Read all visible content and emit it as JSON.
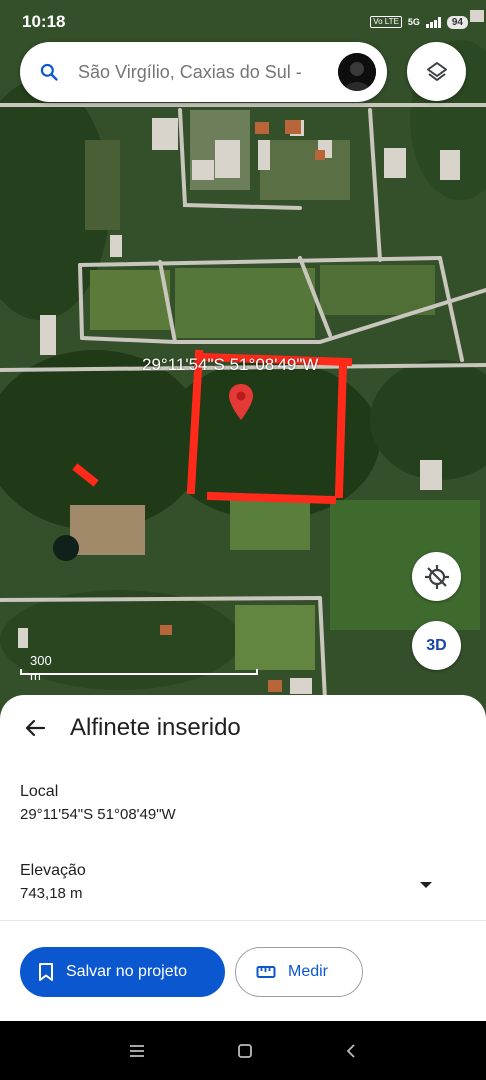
{
  "status_bar": {
    "time": "10:18",
    "volte": "Vo LTE",
    "network": "5G",
    "battery": "94"
  },
  "search": {
    "text": "São Virgílio, Caxias do Sul -",
    "icon": "search-icon"
  },
  "map": {
    "coordinate_overlay": "29°11'54\"S 51°08'49\"W",
    "scale_label": "300 m",
    "btn_3d_label": "3D",
    "marker_color": "#e53935",
    "drawn_outline_color": "#ff2a1a"
  },
  "sheet": {
    "title": "Alfinete inserido",
    "local_label": "Local",
    "local_value": "29°11'54\"S 51°08'49\"W",
    "elevation_label": "Elevação",
    "elevation_value": "743,18 m",
    "save_label": "Salvar no projeto",
    "measure_label": "Medir"
  },
  "colors": {
    "primary": "#0b57d0",
    "sheet_bg": "#ffffff"
  }
}
